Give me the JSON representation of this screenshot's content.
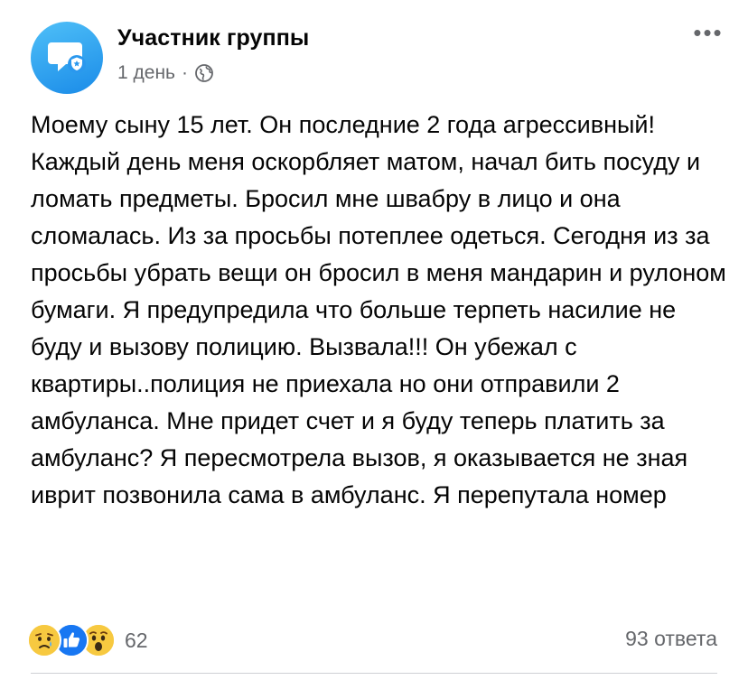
{
  "post": {
    "author": "Участник группы",
    "time": "1 день",
    "separator": "·",
    "privacy_icon": "globe-icon",
    "more_label": "•••",
    "text": "Моему сыну 15 лет. Он последние 2 года агрессивный! Каждый день меня оскорбляет матом, начал бить посуду и ломать предметы. Бросил мне швабру в лицо и она сломалась. Из за просьбы потеплее одеться. Сегодня из за просьбы убрать вещи он бросил в меня мандарин и рулоном бумаги. Я предупредила что больше терпеть насилие не буду и вызову полицию. Вызвала!!! Он убежал с квартиры..полиция не приехала но они отправили 2 амбуланса. Мне придет счет и я буду теперь платить за амбуланс? Я пересмотрела вызов, я оказывается не зная иврит позвонила сама в амбуланс. Я перепутала номер"
  },
  "footer": {
    "reactions": [
      "sad-emoji",
      "like-emoji",
      "wow-emoji"
    ],
    "reaction_count": "62",
    "replies": "93 ответа"
  },
  "colors": {
    "avatar_start": "#4fc0f8",
    "avatar_end": "#1a8be8",
    "meta_text": "#65676b",
    "like_blue": "#1877f2",
    "emoji_yellow": "#f7c940"
  }
}
